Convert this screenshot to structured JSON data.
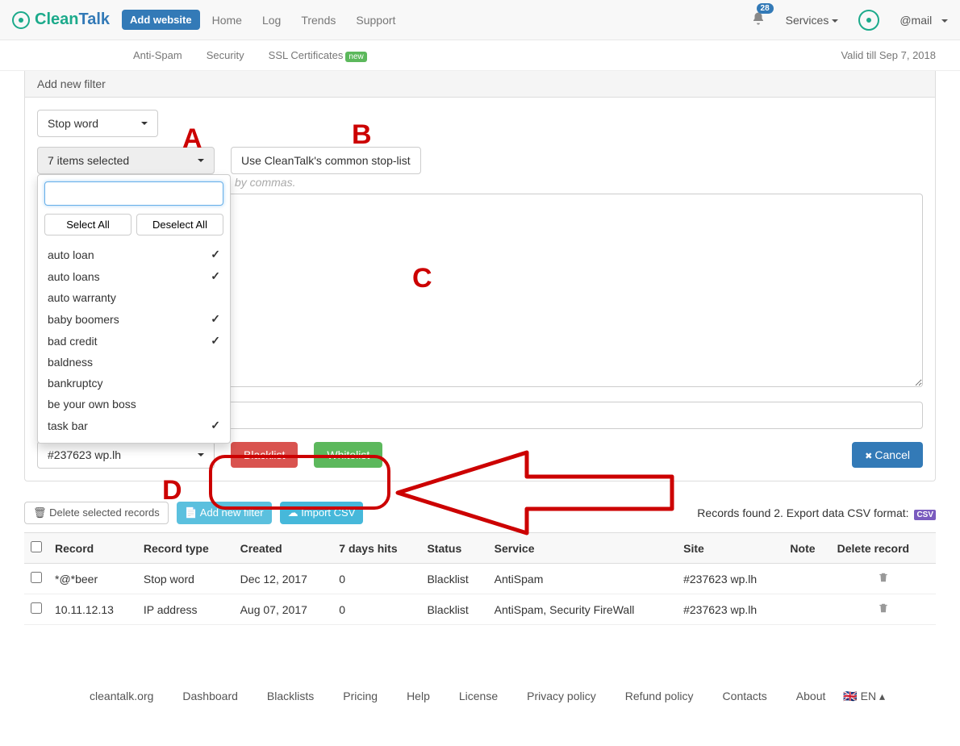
{
  "topnav": {
    "logo_clean": "Clean",
    "logo_talk": "Talk",
    "add_website": "Add website",
    "items": [
      "Home",
      "Log",
      "Trends",
      "Support"
    ],
    "notif_count": "28",
    "services": "Services",
    "mail": "@mail"
  },
  "subnav": {
    "items": [
      "Anti-Spam",
      "Security",
      "SSL Certificates"
    ],
    "new_badge": "new",
    "valid_till": "Valid till Sep 7, 2018"
  },
  "panel": {
    "heading": "Add new filter",
    "filter_type": "Stop word",
    "multiselect_label": "7 items selected",
    "common_stop": "Use CleanTalk's common stop-list",
    "hint_visible_tail": "by commas.",
    "ms_select_all": "Select All",
    "ms_deselect_all": "Deselect All",
    "ms_items": [
      {
        "label": "auto loan",
        "checked": true
      },
      {
        "label": "auto loans",
        "checked": true
      },
      {
        "label": "auto warranty",
        "checked": false
      },
      {
        "label": "baby boomers",
        "checked": true
      },
      {
        "label": "bad credit",
        "checked": true
      },
      {
        "label": "baldness",
        "checked": false
      },
      {
        "label": "bankruptcy",
        "checked": false
      },
      {
        "label": "be your own boss",
        "checked": false
      },
      {
        "label": "task bar",
        "checked": true
      }
    ],
    "site_select": "#237623 wp.lh",
    "btn_blacklist": "Blacklist",
    "btn_whitelist": "Whitelist",
    "btn_cancel": "Cancel"
  },
  "lower": {
    "delete_selected": "Delete selected records",
    "add_new_filter": "Add new filter",
    "import_csv": "Import CSV",
    "records_found": "Records found 2. Export data CSV format:",
    "csv_badge": "CSV",
    "columns": [
      "Record",
      "Record type",
      "Created",
      "7 days hits",
      "Status",
      "Service",
      "Site",
      "Note",
      "Delete record"
    ],
    "rows": [
      {
        "record": "*@*beer",
        "type": "Stop word",
        "created": "Dec 12, 2017",
        "hits": "0",
        "status": "Blacklist",
        "service": "AntiSpam",
        "site": "#237623 wp.lh",
        "note": ""
      },
      {
        "record": "10.11.12.13",
        "type": "IP address",
        "created": "Aug 07, 2017",
        "hits": "0",
        "status": "Blacklist",
        "service": "AntiSpam, Security FireWall",
        "site": "#237623 wp.lh",
        "note": ""
      }
    ]
  },
  "footer": {
    "links": [
      "cleantalk.org",
      "Dashboard",
      "Blacklists",
      "Pricing",
      "Help",
      "License",
      "Privacy policy",
      "Refund policy",
      "Contacts",
      "About"
    ],
    "lang": "EN"
  },
  "annotations": {
    "A": "A",
    "B": "B",
    "C": "C",
    "D": "D"
  }
}
